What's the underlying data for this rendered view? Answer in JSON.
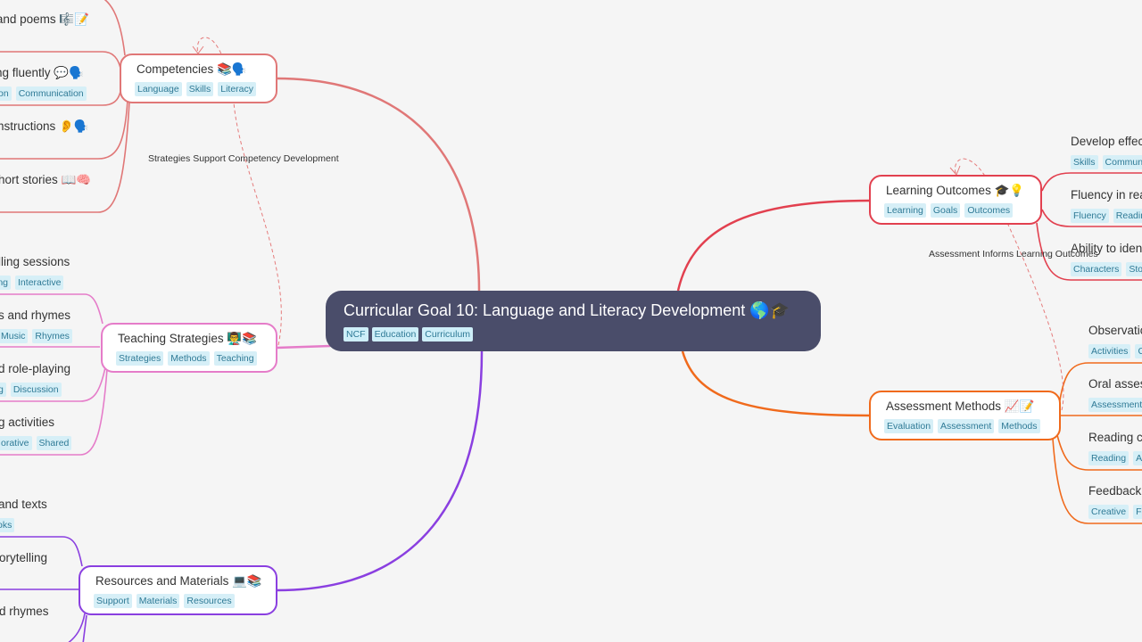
{
  "root": {
    "title": "Curricular Goal 10: Language and Literacy Development 🌎🎓",
    "tags": [
      "NCF",
      "Education",
      "Curriculum"
    ]
  },
  "branches": {
    "competencies": {
      "title": "Competencies 📚🗣️",
      "tags": [
        "Language",
        "Skills",
        "Literacy"
      ],
      "color": "#e07777",
      "children": [
        {
          "title": "and poems 🎼📝",
          "tags": []
        },
        {
          "title": "ng fluently 💬🗣️",
          "tags": [
            "on",
            "Communication"
          ]
        },
        {
          "title": "nstructions 👂🗣️",
          "tags": []
        },
        {
          "title": "hort stories 📖🧠",
          "tags": []
        }
      ]
    },
    "teaching_strategies": {
      "title": "Teaching Strategies 👨‍🏫📚",
      "tags": [
        "Strategies",
        "Methods",
        "Teaching"
      ],
      "color": "#e57cc9",
      "children": [
        {
          "title": "lling sessions",
          "tags": [
            "ing",
            "Interactive"
          ]
        },
        {
          "title": "s and rhymes",
          "tags": [
            "Music",
            "Rhymes"
          ]
        },
        {
          "title": "d role-playing",
          "tags": [
            "g",
            "Discussion"
          ]
        },
        {
          "title": "g activities",
          "tags": [
            "orative",
            "Shared"
          ]
        }
      ]
    },
    "resources": {
      "title": "Resources and Materials 💻📚",
      "tags": [
        "Support",
        "Materials",
        "Resources"
      ],
      "color": "#8a3fe0",
      "children": [
        {
          "title": " and texts",
          "tags": [
            "oks"
          ]
        },
        {
          "title": "orytelling",
          "tags": []
        },
        {
          "title": "d rhymes",
          "tags": []
        }
      ]
    },
    "learning_outcomes": {
      "title": "Learning Outcomes 🎓💡",
      "tags": [
        "Learning",
        "Goals",
        "Outcomes"
      ],
      "color": "#e2404f",
      "children": [
        {
          "title": "Develop effec",
          "tags": [
            "Skills",
            "Commun"
          ]
        },
        {
          "title": "Fluency in rea",
          "tags": [
            "Fluency",
            "Readin"
          ]
        },
        {
          "title": "Ability to iden",
          "tags": [
            "Characters",
            "Stor"
          ]
        }
      ]
    },
    "assessment": {
      "title": "Assessment Methods 📈📝",
      "tags": [
        "Evaluation",
        "Assessment",
        "Methods"
      ],
      "color": "#f06a1c",
      "children": [
        {
          "title": "Observatio",
          "tags": [
            "Activities",
            "C"
          ]
        },
        {
          "title": "Oral asses",
          "tags": [
            "Assessment"
          ]
        },
        {
          "title": "Reading co",
          "tags": [
            "Reading",
            "As"
          ]
        },
        {
          "title": "Feedback",
          "tags": [
            "Creative",
            "Fe"
          ]
        }
      ]
    }
  },
  "relationships": [
    {
      "label": "Strategies Support Competency Development",
      "from": "teaching_strategies",
      "to": "competencies"
    },
    {
      "label": "Assessment Informs Learning Outcomes",
      "from": "assessment",
      "to": "learning_outcomes"
    }
  ]
}
